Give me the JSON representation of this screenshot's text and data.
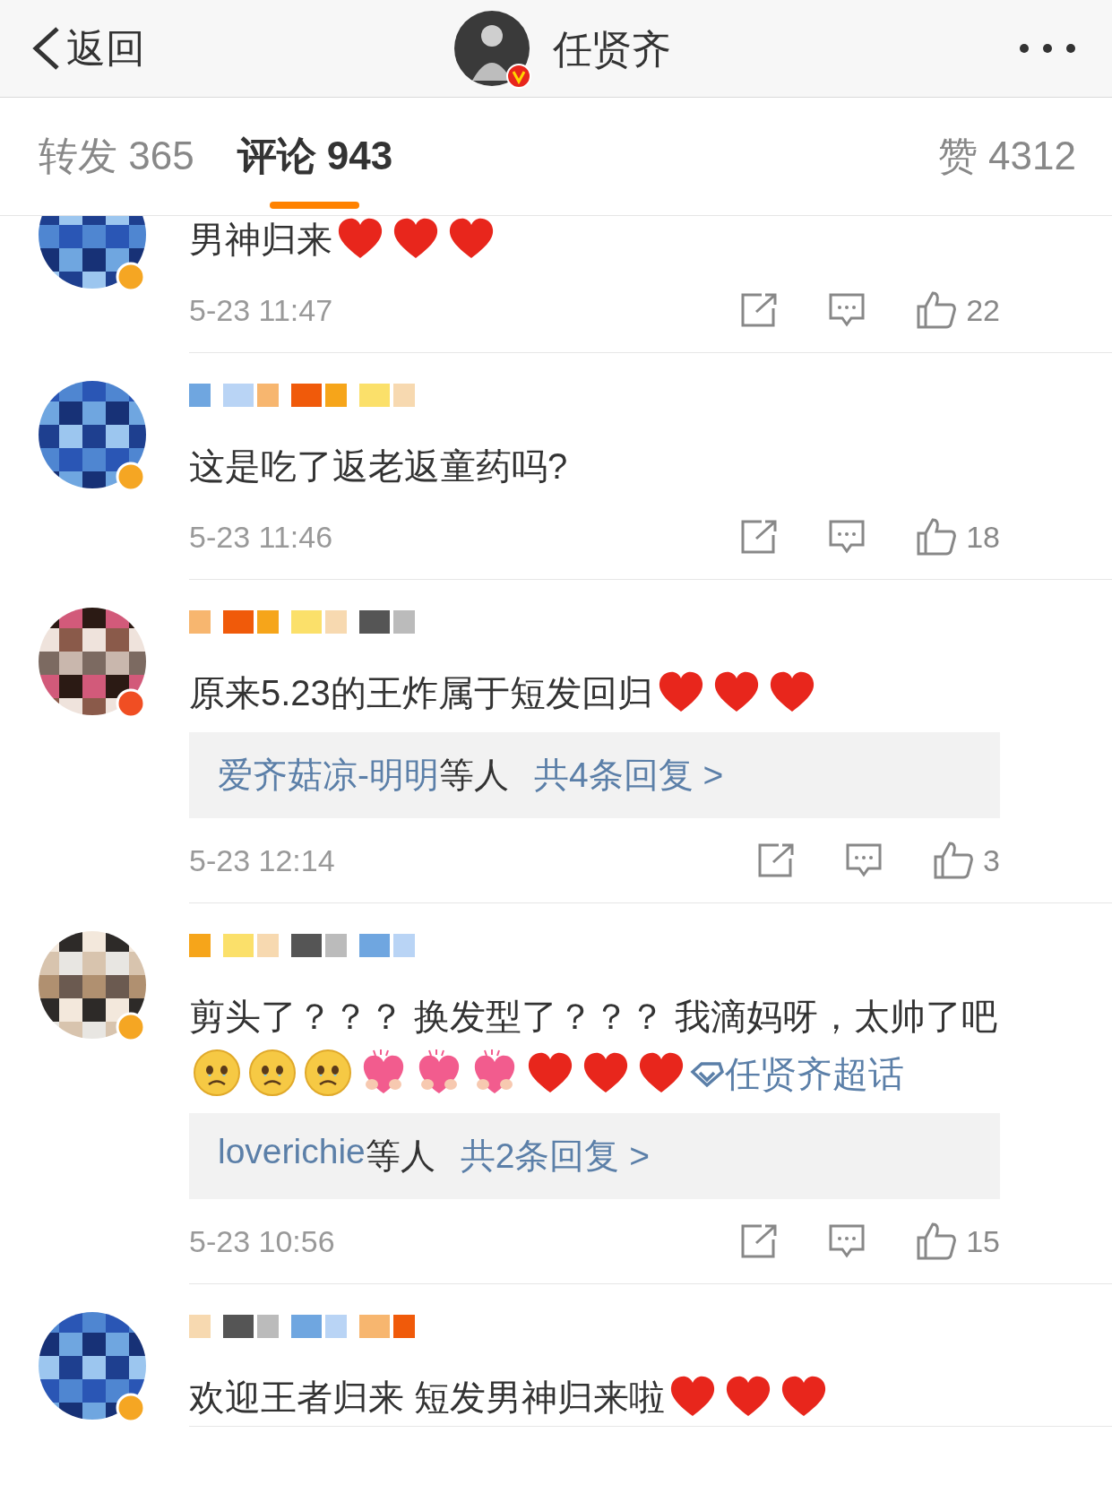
{
  "header": {
    "back": "返回",
    "title": "任贤齐",
    "verified": true
  },
  "tabs": [
    {
      "label": "转发",
      "count": "365",
      "selected": false
    },
    {
      "label": "评论",
      "count": "943",
      "selected": true
    },
    {
      "label": "赞",
      "count": "4312",
      "selected": false
    }
  ],
  "comments": [
    {
      "badge": {
        "color": "#f5a623"
      },
      "content": [
        {
          "kind": "text",
          "text": "男神归来"
        },
        {
          "kind": "heart"
        },
        {
          "kind": "heart"
        },
        {
          "kind": "heart"
        }
      ],
      "time": "5-23 11:47",
      "likes": "22"
    },
    {
      "badge": {
        "color": "#f5a623"
      },
      "content": [
        {
          "kind": "text",
          "text": "这是吃了返老返童药吗?"
        }
      ],
      "time": "5-23 11:46",
      "likes": "18"
    },
    {
      "badge": {
        "color": "#f04e23"
      },
      "content": [
        {
          "kind": "text",
          "text": "原来5.23的王炸属于短发回归"
        },
        {
          "kind": "heart"
        },
        {
          "kind": "heart"
        },
        {
          "kind": "heart"
        }
      ],
      "replies": {
        "user": "爱齐菇凉-明明",
        "suffix": "等人",
        "link": "共4条回复 >"
      },
      "time": "5-23 12:14",
      "likes": "3"
    },
    {
      "badge": {
        "color": "#f5a623"
      },
      "content": [
        {
          "kind": "text",
          "text": "剪头了？？？ 换发型了？？？ 我滴妈呀，太帅了吧"
        },
        {
          "kind": "crying-face"
        },
        {
          "kind": "crying-face"
        },
        {
          "kind": "crying-face"
        },
        {
          "kind": "hugging-heart"
        },
        {
          "kind": "hugging-heart"
        },
        {
          "kind": "hugging-heart"
        },
        {
          "kind": "heart"
        },
        {
          "kind": "heart"
        },
        {
          "kind": "heart"
        },
        {
          "kind": "topic",
          "text": "任贤齐超话"
        }
      ],
      "replies": {
        "user": "loverichie",
        "suffix": "等人",
        "link": "共2条回复 >"
      },
      "time": "5-23 10:56",
      "likes": "15"
    },
    {
      "badge": {
        "color": "#f5a623"
      },
      "content": [
        {
          "kind": "text",
          "text": "欢迎王者归来 短发男神归来啦"
        },
        {
          "kind": "heart"
        },
        {
          "kind": "heart"
        },
        {
          "kind": "heart"
        }
      ]
    }
  ]
}
